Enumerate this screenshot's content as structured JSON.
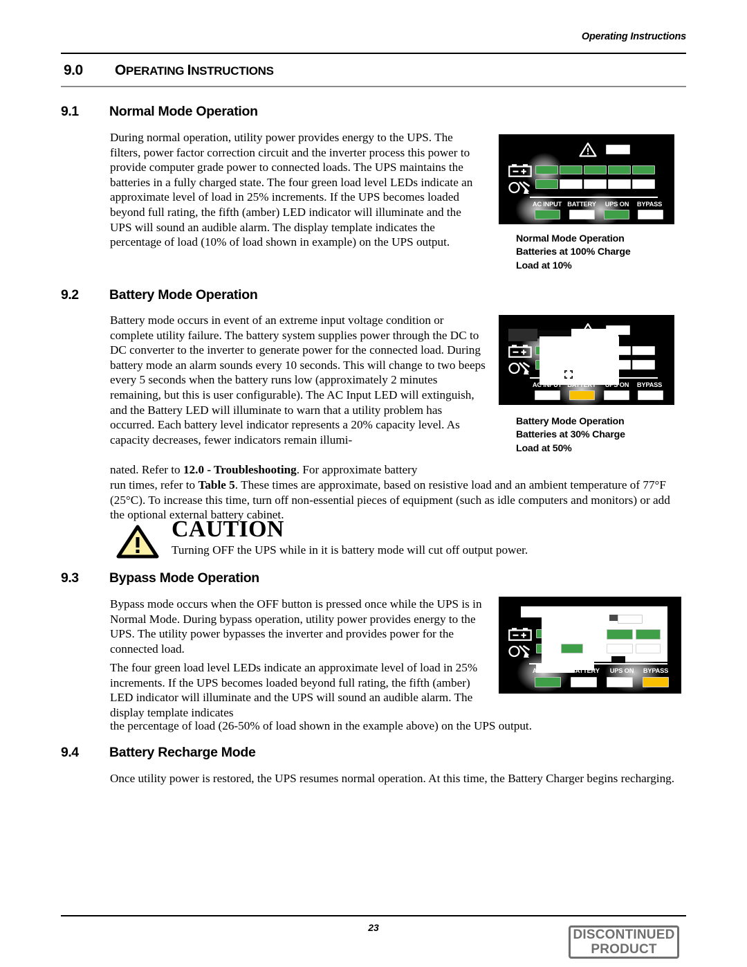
{
  "header": {
    "running_head": "Operating Instructions"
  },
  "chapter": {
    "number": "9.0",
    "title_first": "O",
    "title_rest1": "PERATING ",
    "title_cap2": "I",
    "title_rest2": "NSTRUCTIONS"
  },
  "sections": [
    {
      "number": "9.1",
      "title": "Normal Mode Operation",
      "body": "During normal operation, utility power provides energy to the UPS. The filters, power factor correction circuit and the inverter process this power to provide computer grade power to connected loads. The UPS maintains the batteries in a fully charged state. The four green load level LEDs indicate an approximate level of load in 25% increments. If the UPS becomes loaded beyond full rating, the fifth (amber) LED indicator will illuminate and the UPS will sound an audible alarm. The display template indicates the percentage of load (10% of load shown in example) on the UPS output."
    },
    {
      "number": "9.2",
      "title": "Battery Mode Operation",
      "body_part1": "Battery mode occurs in event of an extreme input voltage condition or complete utility failure. The battery system supplies power through the DC to DC converter to the inverter to generate power for the connected load. During battery mode an alarm sounds every 10 seconds. This will change to two beeps every 5 seconds when the battery runs low (approximately 2 minutes remaining, but this is user configurable). The AC Input LED will extinguish, and the Battery LED will illuminate to warn that a utility problem has occurred. Each battery level indicator represents a 20% capacity level. As capacity decreases, fewer indicators remain illumi-",
      "body_part2_pre": "nated. Refer to ",
      "body_part2_bold": "12.0 - Troubleshooting",
      "body_part2_post": ". For approximate battery",
      "body_part3_pre": "run times, refer to ",
      "body_part3_bold": "Table 5",
      "body_part3_post": ". These times are approximate, based on resistive load and an ambient temperature of 77°F (25°C). To increase this time, turn off non-essential pieces of equipment (such as idle computers and monitors) or add the optional external battery cabinet."
    },
    {
      "number": "9.3",
      "title": "Bypass Mode Operation",
      "body_1": "Bypass mode occurs when the OFF button is pressed once while the UPS is in Normal Mode. During bypass operation, utility power provides energy to the UPS. The utility power bypasses the inverter and provides power for the connected load.",
      "body_2": "The four green load level LEDs indicate an approximate level of load in 25% increments. If the UPS becomes loaded beyond full rating, the fifth (amber) LED indicator will illuminate and the UPS will sound an audible alarm. The display template indicates",
      "body_3": "the percentage of load (26-50% of load shown in the example above) on the UPS output."
    },
    {
      "number": "9.4",
      "title": "Battery Recharge Mode",
      "body": "Once utility power is restored, the UPS resumes normal operation. At this time, the Battery Charger begins recharging."
    }
  ],
  "caution": {
    "word": "CAUTION",
    "text": "Turning OFF the UPS while in it is battery mode will cut off output power.",
    "triangle_fill": "#FBF0A8",
    "icon": "warning-triangle-icon"
  },
  "panels": [
    {
      "id": "normal-mode",
      "status_labels": [
        "AC INPUT",
        "BATTERY",
        "UPS ON",
        "BYPASS"
      ],
      "status_leds": [
        "green",
        "white",
        "green",
        "white"
      ],
      "battery_row": [
        "green",
        "green",
        "green",
        "green",
        "green"
      ],
      "load_row": [
        "green",
        "white",
        "white",
        "white",
        "white"
      ],
      "alarm_led": "white",
      "caption": "Normal Mode Operation\nBatteries at 100% Charge\nLoad at 10%"
    },
    {
      "id": "battery-mode",
      "status_labels": [
        "AC INPUT",
        "BATTERY",
        "UPS ON",
        "BYPASS"
      ],
      "status_leds": [
        "white",
        "amber",
        "white",
        "white"
      ],
      "battery_row": [
        "green",
        "green",
        "white",
        "white",
        "white"
      ],
      "load_row": [
        "green",
        "green",
        "white",
        "white",
        "white"
      ],
      "alarm_led": "white",
      "caption": "Battery Mode Operation\nBatteries at 30% Charge\nLoad at 50%"
    },
    {
      "id": "bypass-mode",
      "status_labels": [
        "AC INPUT",
        "BATTERY",
        "UPS ON",
        "BYPASS"
      ],
      "status_leds": [
        "green",
        "white",
        "white",
        "amber"
      ],
      "battery_row": [
        "green",
        "green",
        "green",
        "green",
        "green"
      ],
      "load_row": [
        "green",
        "green",
        "white",
        "white",
        "white"
      ],
      "alarm_led": "white",
      "caption": ""
    }
  ],
  "panel_colors": {
    "background": "#000000",
    "green": "#3F9E48",
    "amber": "#F8C000",
    "off": "#FFFFFF",
    "border": "#C9CDD0"
  },
  "footer": {
    "page_number": "23",
    "stamp_line1": "DISCONTINUED",
    "stamp_line2": "PRODUCT",
    "stamp_color": "#6F6F6F"
  }
}
